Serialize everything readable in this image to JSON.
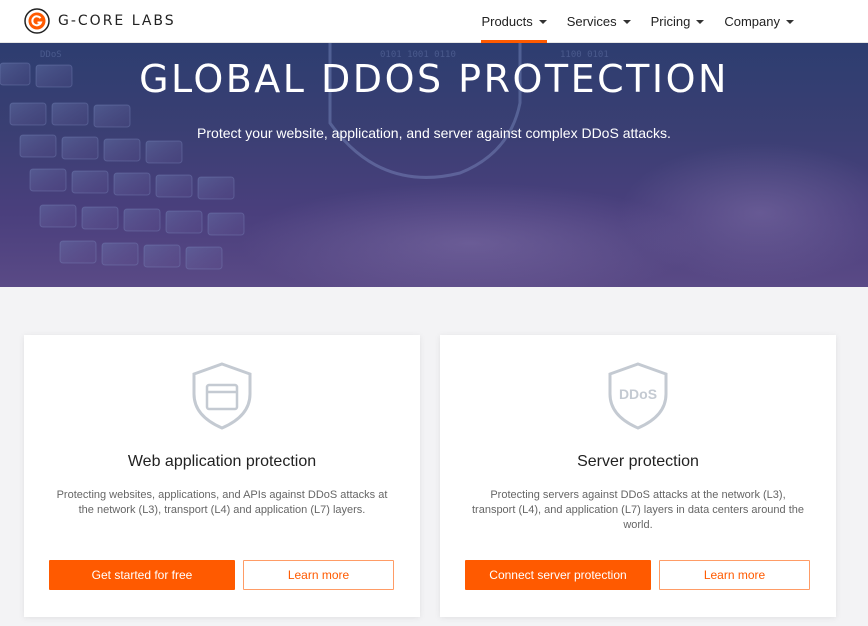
{
  "header": {
    "logo_text": "G-CORE LABS",
    "nav": [
      {
        "label": "Products",
        "active": true
      },
      {
        "label": "Services",
        "active": false
      },
      {
        "label": "Pricing",
        "active": false
      },
      {
        "label": "Company",
        "active": false
      }
    ]
  },
  "hero": {
    "title": "GLOBAL DDOS PROTECTION",
    "subtitle": "Protect your website, application, and server against complex DDoS attacks."
  },
  "cards": [
    {
      "icon": "shield-browser-icon",
      "title": "Web application protection",
      "description": "Protecting websites, applications, and APIs against DDoS attacks at the network (L3), transport (L4) and application (L7) layers.",
      "primary_button": "Get started for free",
      "secondary_button": "Learn more"
    },
    {
      "icon": "shield-ddos-icon",
      "icon_text": "DDoS",
      "title": "Server protection",
      "description": "Protecting servers against DDoS attacks at the network (L3), transport (L4), and application (L7) layers in data centers around the world.",
      "primary_button": "Connect server protection",
      "secondary_button": "Learn more"
    }
  ],
  "colors": {
    "accent": "#ff5a00",
    "hero_dark": "#2d3d70",
    "hero_light": "#5a4a86"
  }
}
